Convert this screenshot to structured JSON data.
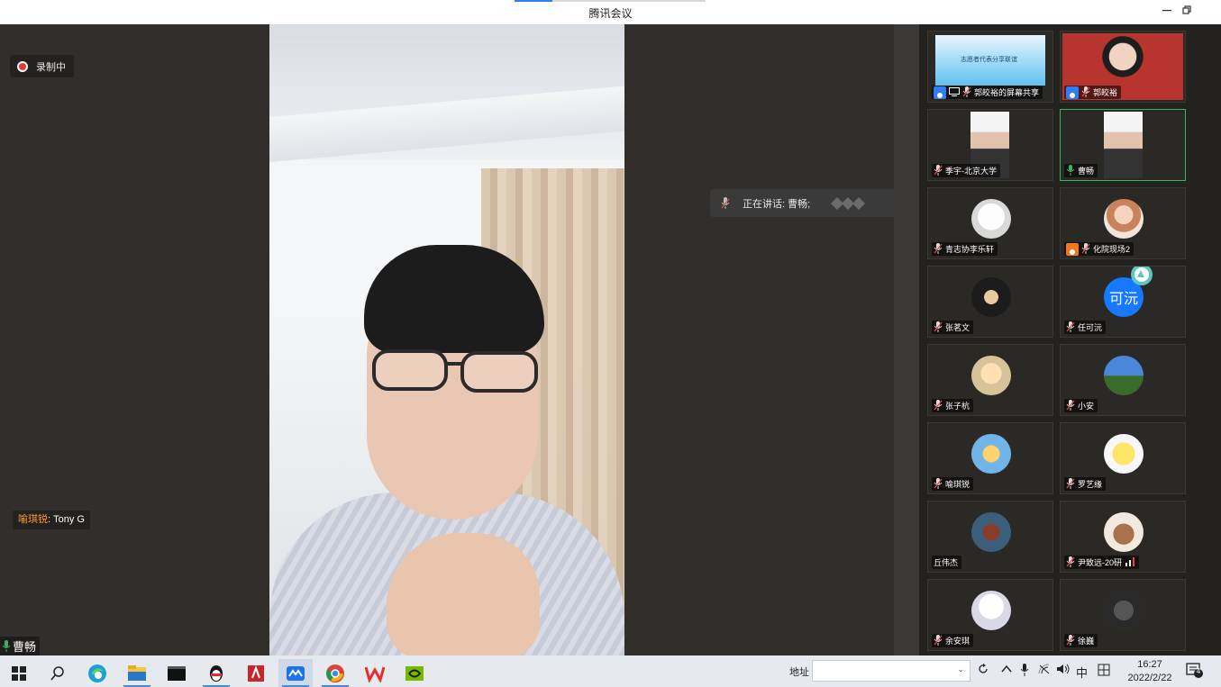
{
  "window": {
    "title": "腾讯会议",
    "controls": [
      "minimize",
      "restore"
    ]
  },
  "stage": {
    "recording_label": "录制中",
    "subtitle": {
      "speaker": "喻琪锐",
      "separator": ": ",
      "text": "Tony G"
    },
    "self_name": "曹畅",
    "speaking_now": "正在讲话: 曹畅;"
  },
  "participants": [
    {
      "name": "郭皎裕的屏幕共享",
      "badge_color": "#2f7cf6",
      "share_text": "志愿者代表分享联谊"
    },
    {
      "name": "郭皎裕",
      "badge_color": "#2f7cf6"
    },
    {
      "name": "季宇-北京大学"
    },
    {
      "name": "曹畅",
      "active": true
    },
    {
      "name": "青志协李乐轩"
    },
    {
      "name": "化院现场2",
      "badge_color": "#f0781e"
    },
    {
      "name": "张茗文"
    },
    {
      "name": "任可沅",
      "initial": "可沅"
    },
    {
      "name": "张子杭"
    },
    {
      "name": "小安"
    },
    {
      "name": "喻琪锐"
    },
    {
      "name": "罗艺缘"
    },
    {
      "name": "丘伟杰"
    },
    {
      "name": "尹致远-20研"
    },
    {
      "name": "余安琪"
    },
    {
      "name": "徐巍"
    }
  ],
  "taskbar": {
    "apps": [
      "windows-start",
      "search",
      "edge",
      "file-explorer",
      "terminal",
      "qq",
      "autocad",
      "tencent-meeting",
      "chrome",
      "wps",
      "nvidia"
    ],
    "address_label": "地址",
    "address_value": "",
    "ime": "中",
    "clock_time": "16:27",
    "clock_date": "2022/2/22",
    "notification_count": "4"
  },
  "colors": {
    "accent": "#2f7cf6",
    "record": "#e53935",
    "active_border": "#3ab35c",
    "subtitle_name": "#ff9b2f"
  }
}
